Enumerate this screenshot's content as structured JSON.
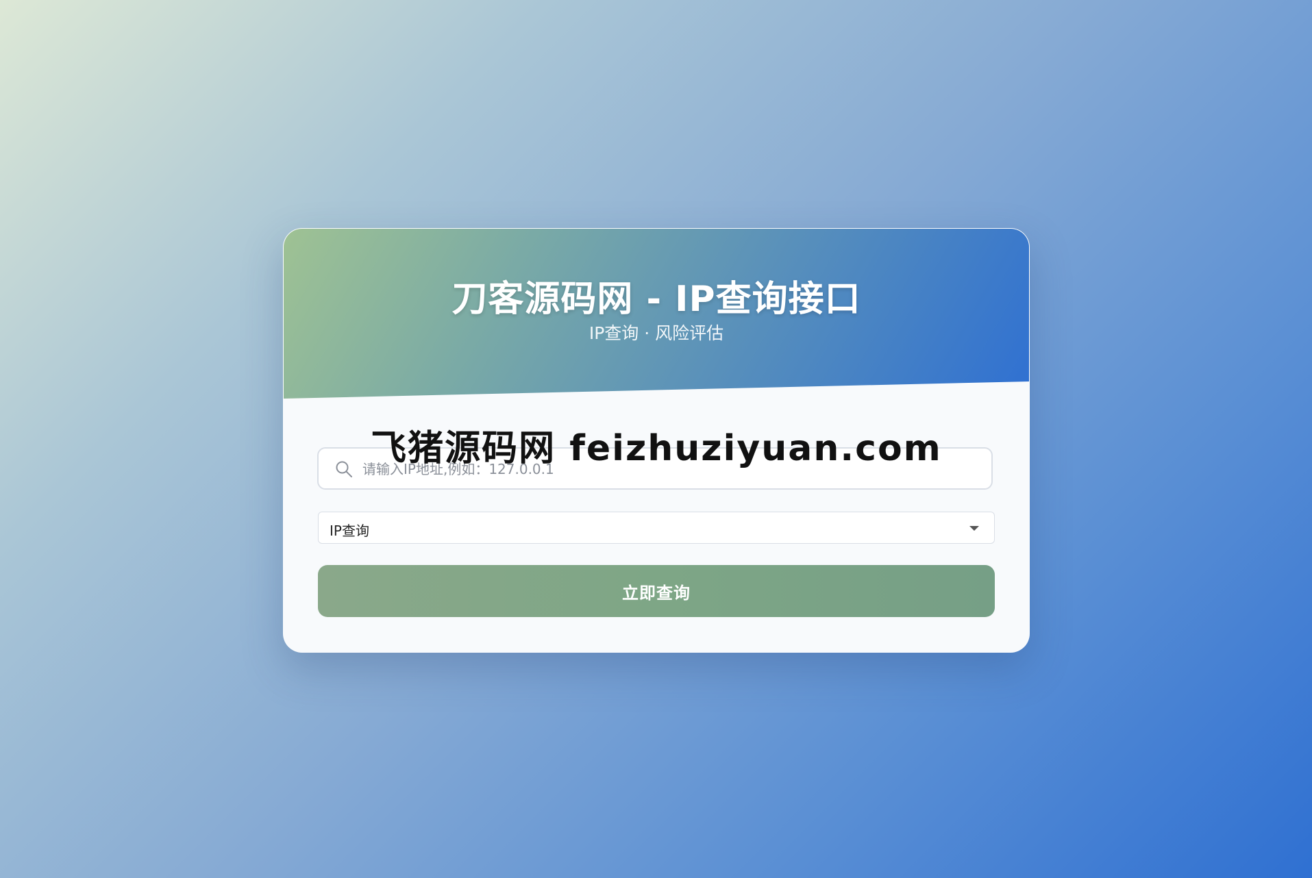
{
  "header": {
    "title": "刀客源码网 - IP查询接口",
    "subtitle": "IP查询 · 风险评估"
  },
  "watermark": {
    "text": "飞猪源码网 feizhuziyuan.com"
  },
  "search": {
    "icon": "search-icon",
    "placeholder": "请输入IP地址,例如：127.0.0.1",
    "value": ""
  },
  "query_type": {
    "selected": "IP查询",
    "icon": "chevron-down-icon"
  },
  "submit": {
    "label": "立即查询"
  },
  "colors": {
    "accent_start": "#9fc293",
    "accent_end": "#2f70d2",
    "button": "#7ea686"
  }
}
